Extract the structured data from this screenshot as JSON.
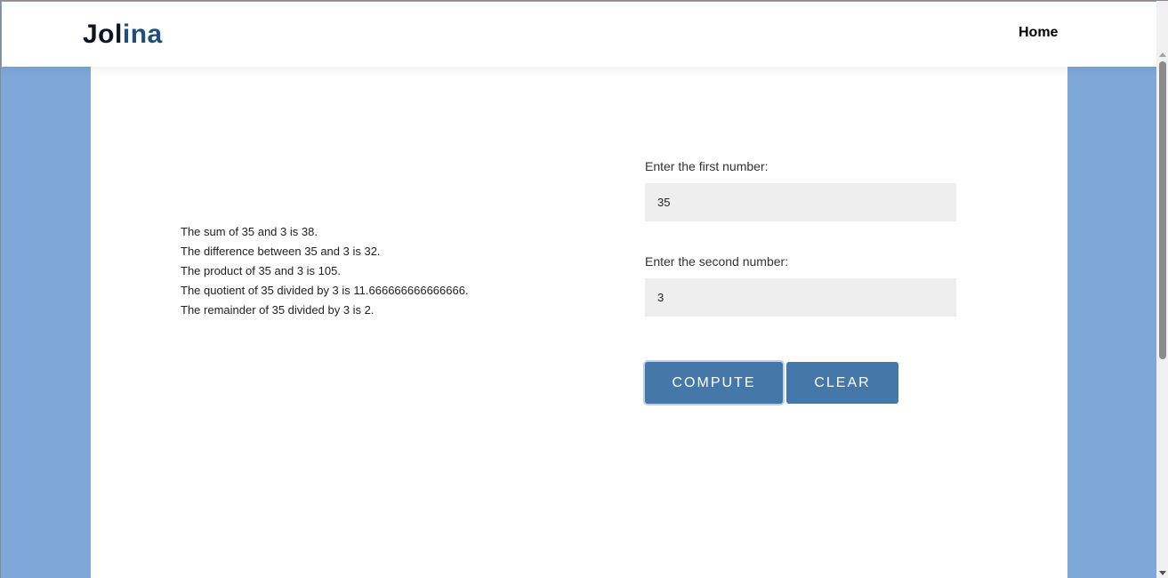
{
  "navbar": {
    "logo_part1": "Jol",
    "logo_part2": "ina",
    "home_link": "Home"
  },
  "results": [
    "The sum of 35 and 3 is 38.",
    "The difference between 35 and 3 is 32.",
    "The product of 35 and 3 is 105.",
    "The quotient of 35 divided by 3 is 11.666666666666666.",
    "The remainder of 35 divided by 3 is 2."
  ],
  "form": {
    "first_label": "Enter the first number:",
    "first_value": "35",
    "second_label": "Enter the second number:",
    "second_value": "3",
    "compute_label": "COMPUTE",
    "clear_label": "CLEAR"
  },
  "colors": {
    "background_band": "#7ea8d8",
    "button": "#4578a8",
    "logo_accent": "#1f4e7a",
    "input_bg": "#eeeeee"
  }
}
